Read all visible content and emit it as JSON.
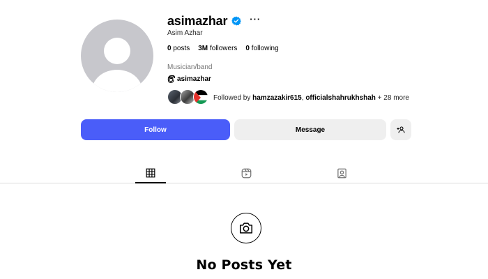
{
  "profile": {
    "username": "asimazhar",
    "verified": true,
    "more_label": "···",
    "full_name": "Asim Azhar",
    "category": "Musician/band",
    "threads_handle": "asimazhar"
  },
  "stats": {
    "posts_count": "0",
    "posts_label": "posts",
    "followers_count": "3M",
    "followers_label": "followers",
    "following_count": "0",
    "following_label": "following"
  },
  "followed_by": {
    "prefix": "Followed by",
    "users": [
      "hamzazakir615",
      "officialshahrukhshah"
    ],
    "separator": ",",
    "suffix": "+ 28 more"
  },
  "actions": {
    "follow_label": "Follow",
    "message_label": "Message",
    "suggest_icon": "add-person-icon"
  },
  "tabs": [
    {
      "name": "posts",
      "icon": "grid-icon",
      "active": true
    },
    {
      "name": "reels",
      "icon": "reels-icon",
      "active": false
    },
    {
      "name": "tagged",
      "icon": "tagged-icon",
      "active": false
    }
  ],
  "empty_state": {
    "icon": "camera-icon",
    "title": "No Posts Yet"
  },
  "colors": {
    "follow_button": "#4a5df9",
    "secondary_button": "#efefef",
    "verified_badge": "#0095f6",
    "avatar_placeholder": "#c7c7cc"
  }
}
